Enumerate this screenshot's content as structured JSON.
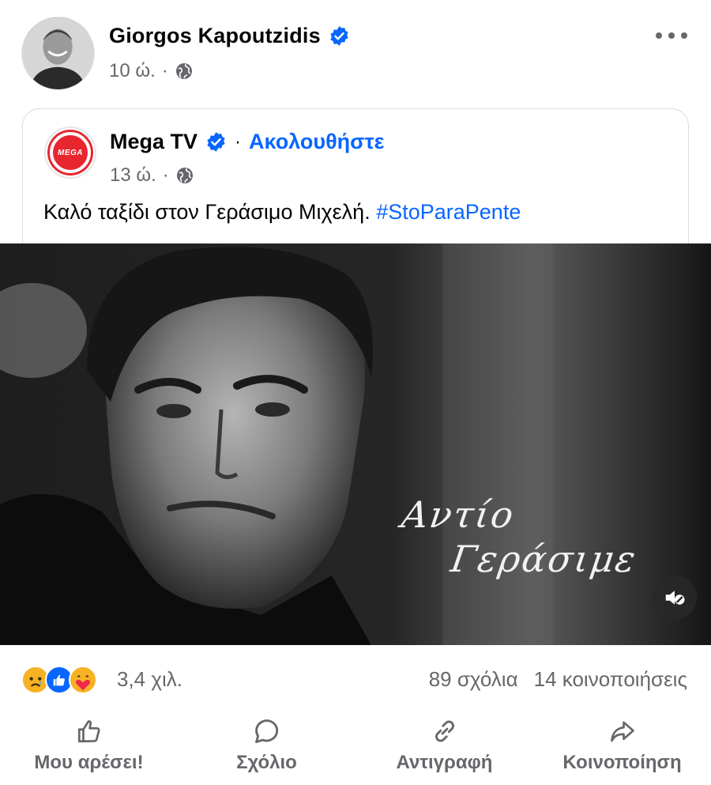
{
  "post": {
    "author": "Giorgos Kapoutzidis",
    "time": "10 ώ.",
    "separator": "·"
  },
  "shared": {
    "page_name": "Mega TV",
    "separator": "·",
    "follow_label": "Ακολουθήστε",
    "time": "13 ώ.",
    "logo_text": "MEGA",
    "text": "Καλό ταξίδι στον Γεράσιμο Μιχελή. ",
    "hashtag": "#StoParaPente",
    "caption_line1": "Αντίο",
    "caption_line2": "Γεράσιμε"
  },
  "stats": {
    "reactions_count": "3,4 χιλ.",
    "comments": "89 σχόλια",
    "shares": "14 κοινοποιήσεις"
  },
  "actions": {
    "like": "Μου αρέσει!",
    "comment": "Σχόλιο",
    "copy": "Αντιγραφή",
    "share": "Κοινοποίηση"
  },
  "colors": {
    "accent": "#0866ff",
    "secondary_text": "#65676b",
    "mega_red": "#e8262f"
  },
  "icons": {
    "verified": "verified-badge-icon",
    "globe": "globe-icon",
    "more": "more-horizontal-icon",
    "mute": "volume-muted-icon",
    "reactions": [
      "sad-reaction-icon",
      "like-reaction-icon",
      "care-reaction-icon"
    ],
    "actions": [
      "thumbs-up-icon",
      "comment-bubble-icon",
      "link-icon",
      "share-arrow-icon"
    ]
  }
}
